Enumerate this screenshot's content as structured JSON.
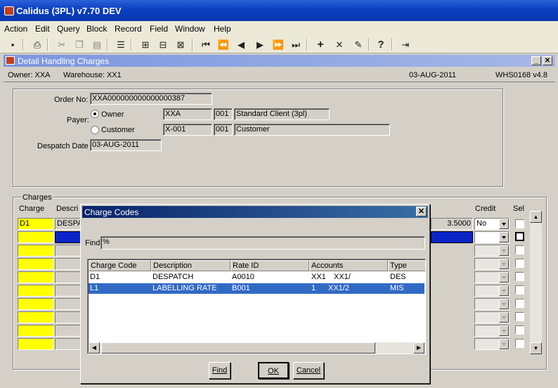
{
  "app": {
    "title": "Calidus (3PL) v7.70 DEV"
  },
  "menu": [
    "Action",
    "Edit",
    "Query",
    "Block",
    "Record",
    "Field",
    "Window",
    "Help"
  ],
  "toolbar": {
    "icons": [
      "save-icon",
      "print-icon",
      "cut-icon",
      "copy-icon",
      "paste-icon",
      "list-icon",
      "insert-record-icon",
      "duplicate-record-icon",
      "clear-record-icon",
      "first-record-icon",
      "previous-set-icon",
      "previous-record-icon",
      "next-record-icon",
      "next-set-icon",
      "last-record-icon",
      "add-icon",
      "delete-icon",
      "query-icon",
      "help-icon",
      "exit-icon"
    ]
  },
  "subwindow": {
    "title": "Detail Handling Charges"
  },
  "info": {
    "owner": "Owner:  XXA",
    "warehouse": "Warehouse:  XX1",
    "date": "03-AUG-2011",
    "screen_code": "WHS0168  v4.8"
  },
  "header": {
    "order_no_label": "Order No:",
    "order_no": "XXA000000000000000387",
    "payer_label": "Payer:",
    "owner_radio": "Owner",
    "owner_code": "XXA",
    "owner_num": "001",
    "owner_name": "Standard Client (3pl)",
    "customer_radio": "Customer",
    "customer_code": "X-001",
    "customer_num": "001",
    "customer_name": "Customer",
    "despatch_label": "Despatch Date",
    "despatch_date": "03-AUG-2011"
  },
  "charges": {
    "group_label": "Charges",
    "col_charge": "Charge",
    "col_description": "Descri",
    "col_credit": "Credit",
    "col_sel": "Sel",
    "row1_charge": "D1",
    "row1_description": "DESPA",
    "row1_rate": "3.5000",
    "row1_credit": "No"
  },
  "dialog": {
    "title": "Charge Codes",
    "find_label": "Find",
    "find_value": "%",
    "columns": [
      "Charge Code",
      "Description",
      "Rate ID",
      "Accounts",
      "Type"
    ],
    "rows": [
      {
        "code": "D1",
        "description": "DESPATCH",
        "rate_id": "A0010",
        "acc1": "XX1",
        "acc2": "XX1/",
        "type": "DES"
      },
      {
        "code": "L1",
        "description": "LABELLING RATE",
        "rate_id": "B001",
        "acc1": "1",
        "acc2": "XX1/2",
        "type": "MIS"
      }
    ],
    "find_button": "Find",
    "ok_button": "OK",
    "cancel_button": "Cancel"
  },
  "colors": {
    "title_blue": "#0a3fc0",
    "required_yellow": "#ffff00",
    "selection_blue": "#316ac5"
  }
}
